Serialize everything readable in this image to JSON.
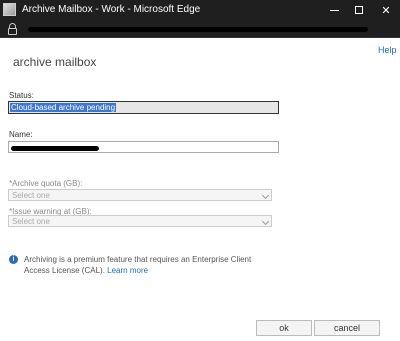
{
  "window": {
    "title": "Archive Mailbox - Work - Microsoft Edge",
    "icons": [
      "app-icon",
      "minimize-icon",
      "maximize-icon",
      "close-icon",
      "lock-icon"
    ]
  },
  "page": {
    "help": "Help",
    "title": "archive mailbox"
  },
  "form": {
    "status_label": "Status:",
    "status_value": "Cloud-based archive pending",
    "name_label": "Name:",
    "quota_label": "*Archive quota (GB):",
    "quota_value": "Select one",
    "warning_label": "*Issue warning at (GB):",
    "warning_value": "Select one"
  },
  "info": {
    "text": "Archiving is a premium feature that requires an Enterprise Client Access License (CAL). ",
    "link": "Learn more",
    "icon": "info-icon"
  },
  "buttons": {
    "ok": "ok",
    "cancel": "cancel"
  },
  "colors": {
    "titlebar": "#1f1f1f",
    "link": "#1a6fb5",
    "selection": "#3b78d4"
  }
}
